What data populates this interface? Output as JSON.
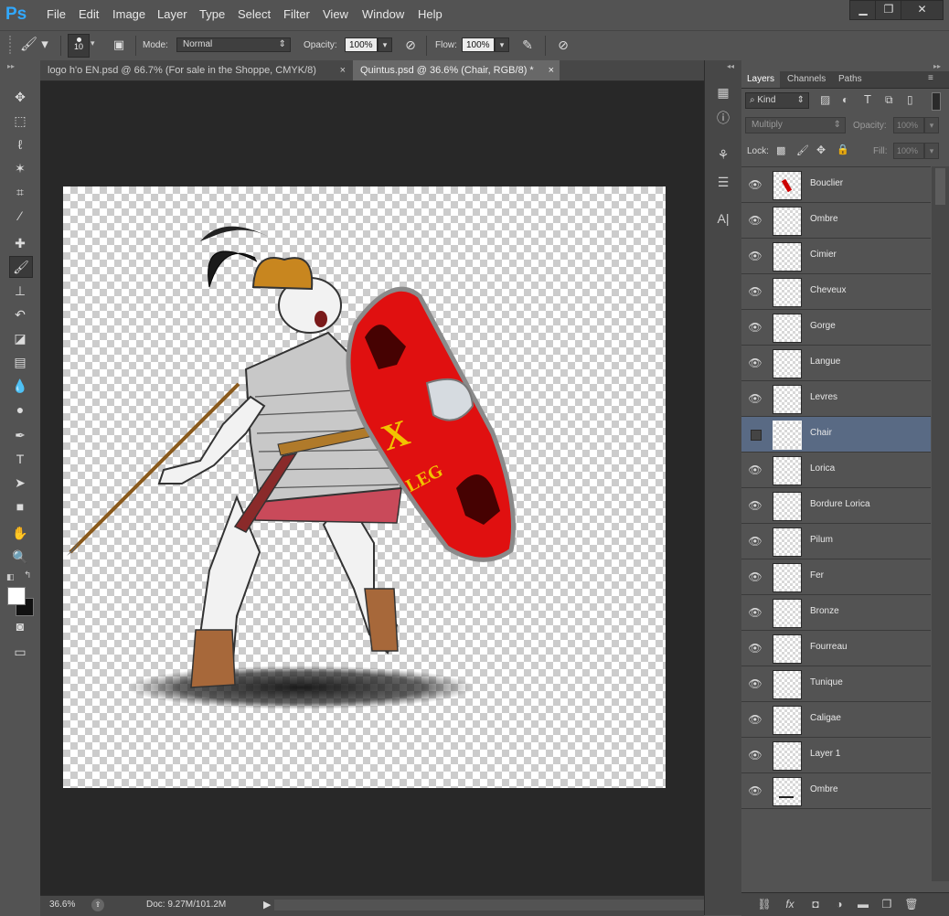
{
  "app": {
    "logo": "Ps"
  },
  "menu": [
    "File",
    "Edit",
    "Image",
    "Layer",
    "Type",
    "Select",
    "Filter",
    "View",
    "Window",
    "Help"
  ],
  "window_controls": {
    "minimize": "▁",
    "maximize": "❐",
    "close": "✕"
  },
  "options_bar": {
    "brush_size": "10",
    "mode_label": "Mode:",
    "mode_value": "Normal",
    "opacity_label": "Opacity:",
    "opacity_value": "100%",
    "flow_label": "Flow:",
    "flow_value": "100%"
  },
  "tabs": [
    {
      "label": "logo h'o EN.psd @ 66.7% (For sale in the Shoppe, CMYK/8)",
      "close": "×"
    },
    {
      "label": "Quintus.psd @ 36.6% (Chair, RGB/8) *",
      "close": "×"
    }
  ],
  "status": {
    "zoom": "36.6%",
    "doc": "Doc: 9.27M/101.2M"
  },
  "shield": {
    "numeral": "X",
    "text": "LEG",
    "color": "#e01010",
    "text_color": "#f2c200"
  },
  "panel": {
    "tabs": [
      "Layers",
      "Channels",
      "Paths"
    ],
    "filter_kind": "Kind",
    "blend_mode": "Multiply",
    "opacity_label": "Opacity:",
    "opacity_value": "100%",
    "lock_label": "Lock:",
    "fill_label": "Fill:",
    "fill_value": "100%",
    "selected_color": "#596a84",
    "layers": [
      {
        "name": "Bouclier",
        "visible": true
      },
      {
        "name": "Ombre",
        "visible": true
      },
      {
        "name": "Cimier",
        "visible": true
      },
      {
        "name": "Cheveux",
        "visible": true
      },
      {
        "name": "Gorge",
        "visible": true
      },
      {
        "name": "Langue",
        "visible": true
      },
      {
        "name": "Levres",
        "visible": true
      },
      {
        "name": "Chair",
        "visible": false,
        "selected": true
      },
      {
        "name": "Lorica",
        "visible": true
      },
      {
        "name": "Bordure Lorica",
        "visible": true
      },
      {
        "name": "Pilum",
        "visible": true
      },
      {
        "name": "Fer",
        "visible": true
      },
      {
        "name": "Bronze",
        "visible": true
      },
      {
        "name": "Fourreau",
        "visible": true
      },
      {
        "name": "Tunique",
        "visible": true
      },
      {
        "name": "Caligae",
        "visible": true
      },
      {
        "name": "Layer 1",
        "visible": true
      },
      {
        "name": "Ombre",
        "visible": true
      }
    ]
  }
}
